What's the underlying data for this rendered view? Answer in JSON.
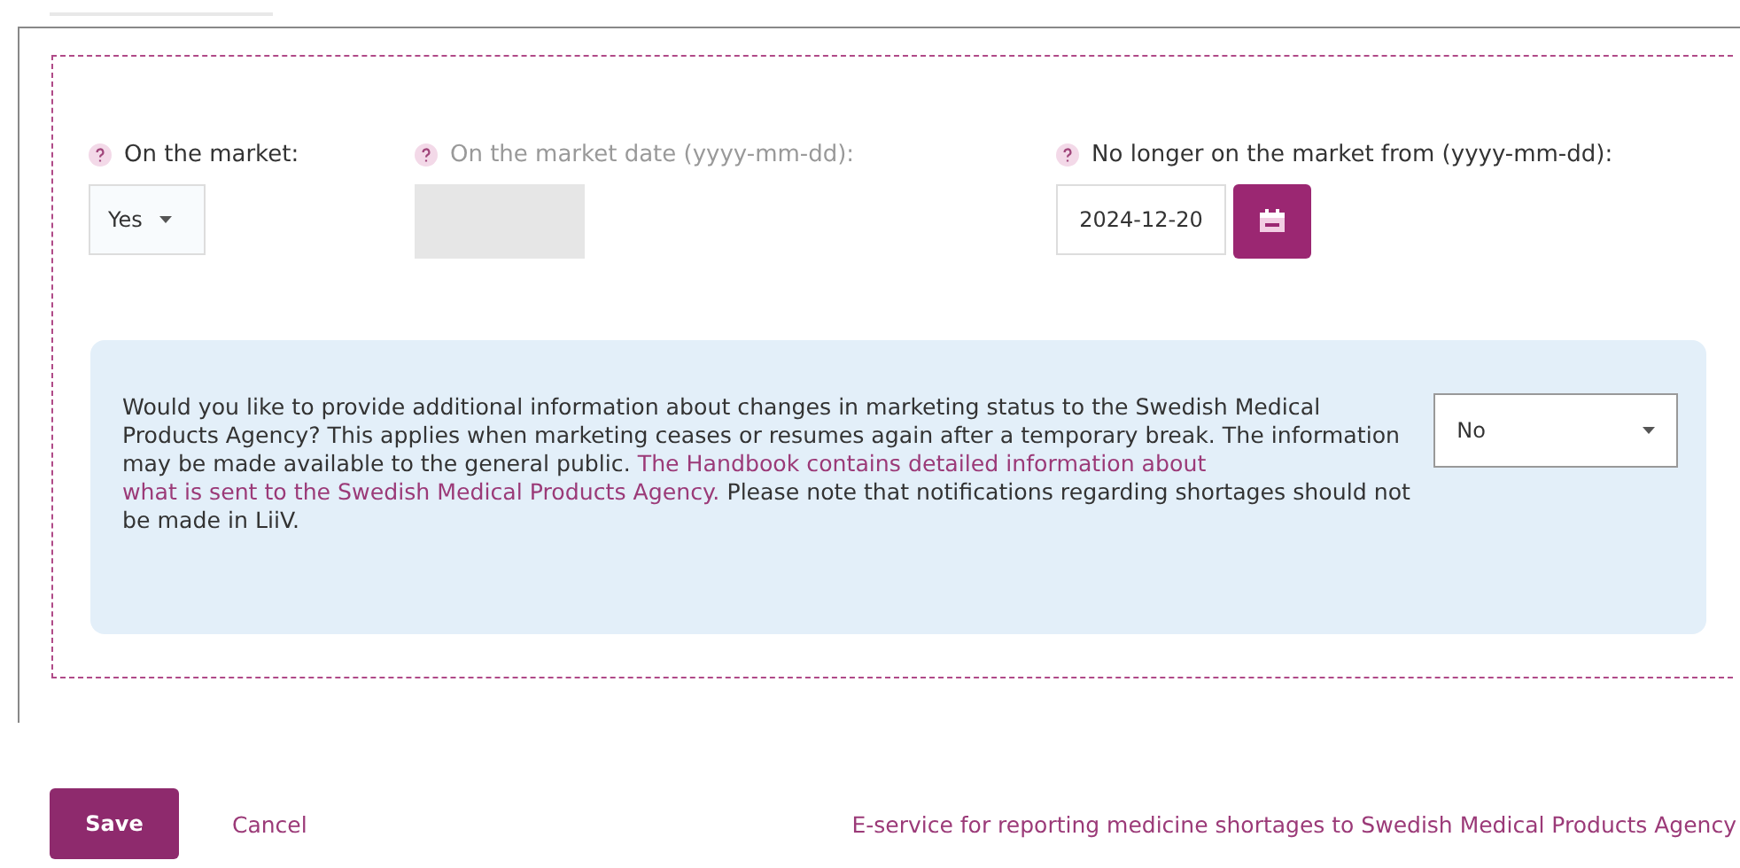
{
  "fields": [
    {
      "label": "On the market:",
      "disabled": false,
      "kind": "select",
      "value": "Yes"
    },
    {
      "label": "On the market date (yyyy-mm-dd):",
      "disabled": true,
      "kind": "date_empty"
    },
    {
      "label": "No longer on the market from (yyyy-mm-dd):",
      "disabled": false,
      "kind": "date",
      "value": "2024-12-20"
    }
  ],
  "info": {
    "text_before": "Would you like to provide additional information about changes in marketing status to the Swedish Medical Products Agency? This applies when marketing ceases or resumes again after a temporary break. The information may be made available to the general public.",
    "link_lines": [
      "The Handbook contains detailed information about",
      "what is sent to the Swedish Medical Products Agency."
    ],
    "text_after": "Please note that notifications regarding shortages should not be made in LiiV.",
    "select_value": "No"
  },
  "footer": {
    "save": "Save",
    "cancel": "Cancel",
    "link": "E-service for reporting medicine shortages to Swedish Medical Products Agency"
  }
}
